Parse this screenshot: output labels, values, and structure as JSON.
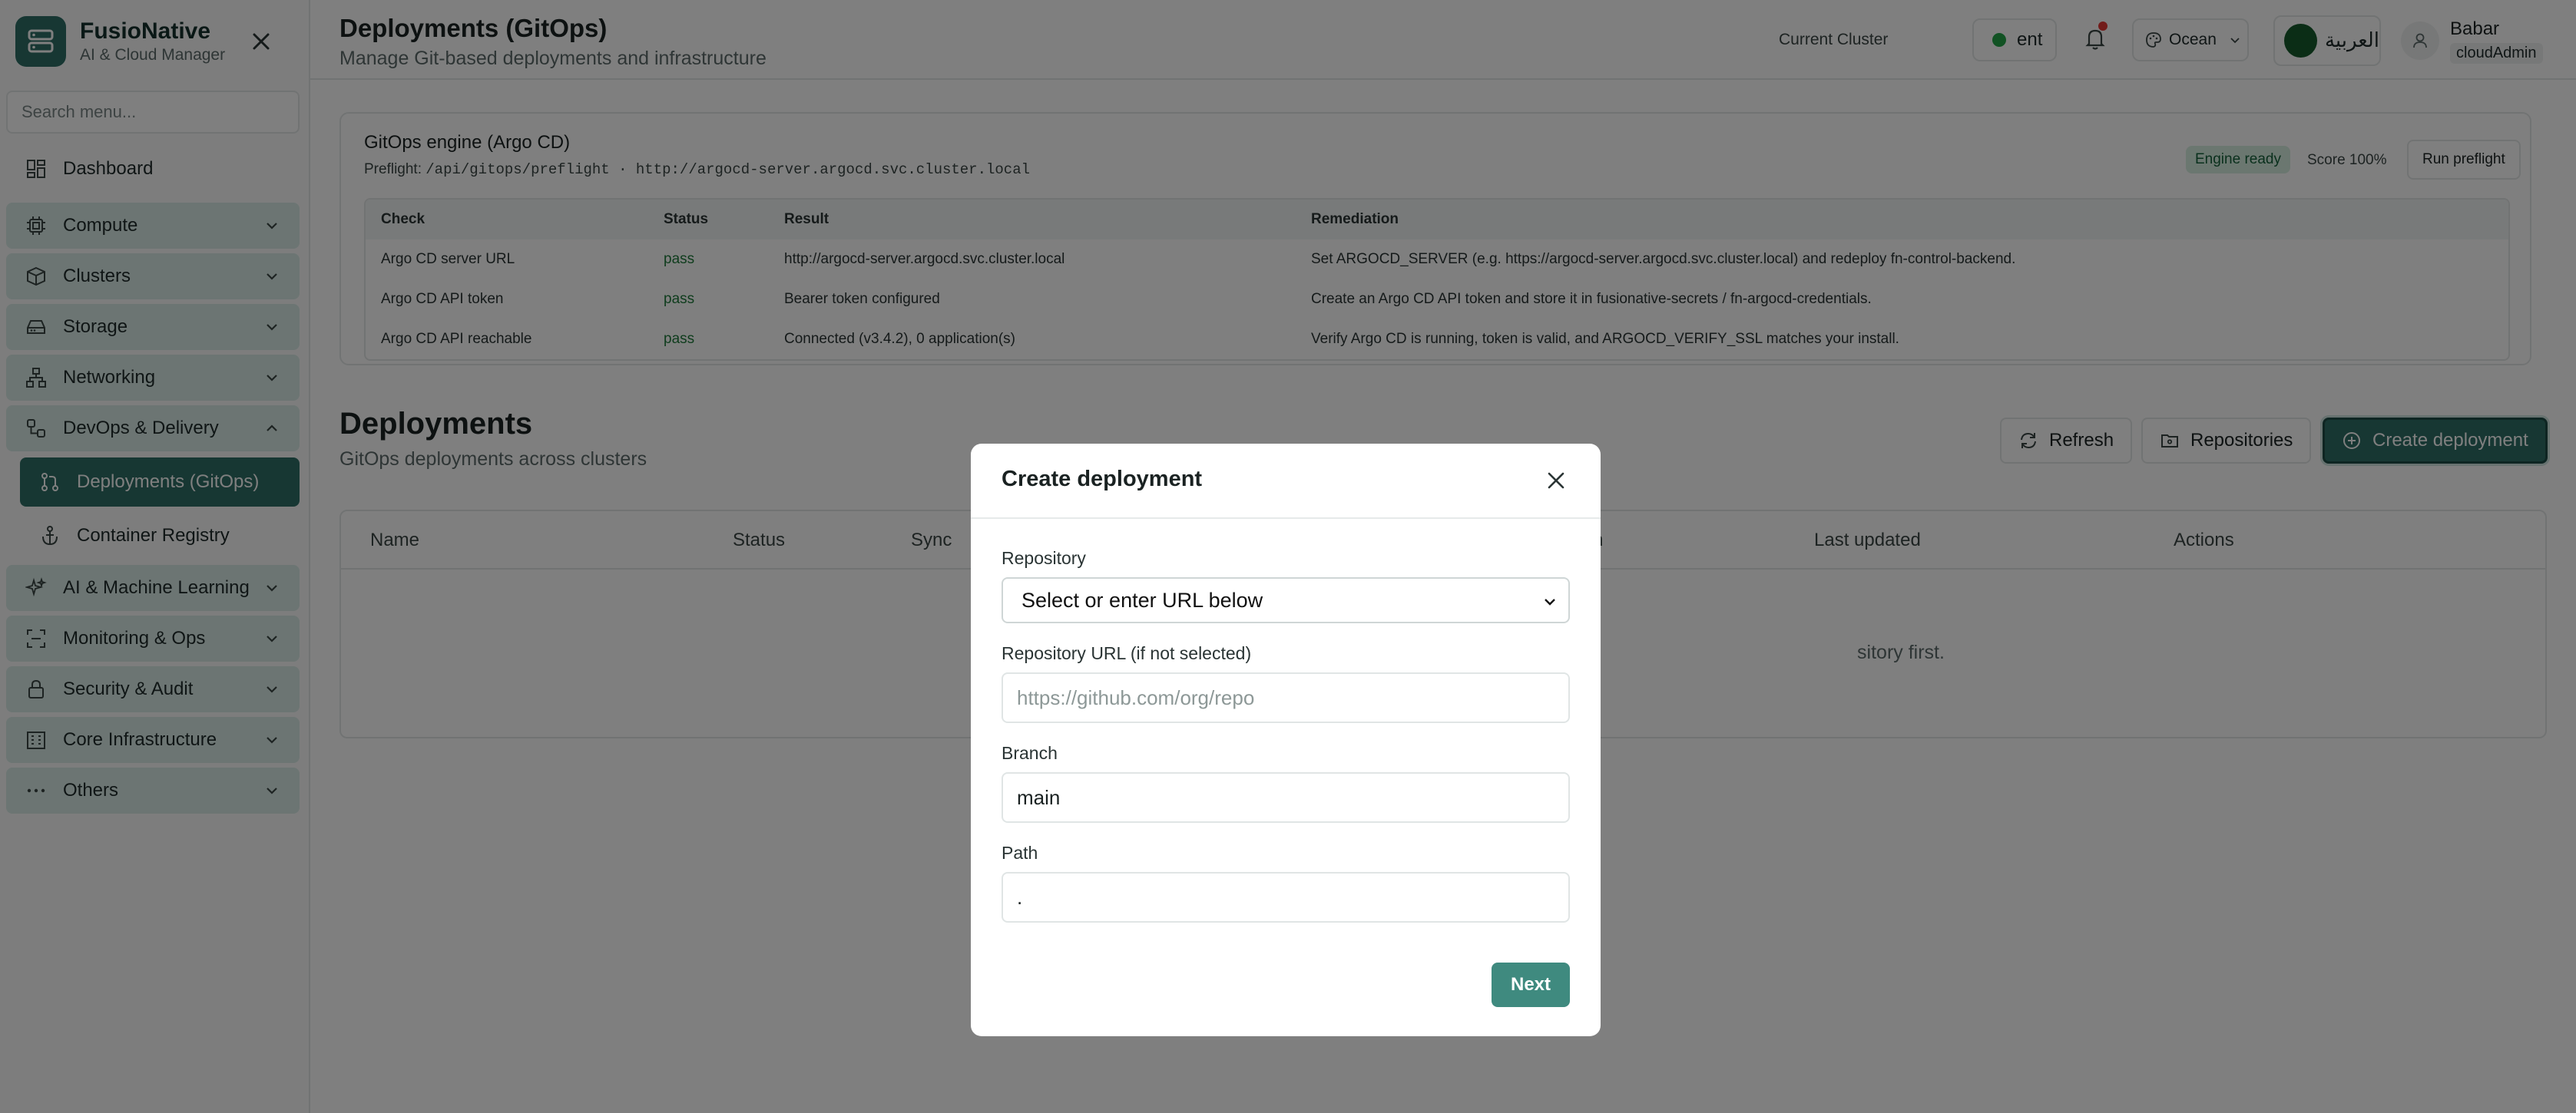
{
  "app": {
    "name": "FusioNative",
    "subtitle": "AI & Cloud Manager"
  },
  "sidebar": {
    "search_placeholder": "Search menu...",
    "items": [
      {
        "label": "Dashboard"
      },
      {
        "label": "Compute"
      },
      {
        "label": "Clusters"
      },
      {
        "label": "Storage"
      },
      {
        "label": "Networking"
      },
      {
        "label": "DevOps & Delivery"
      },
      {
        "label": "Deployments (GitOps)"
      },
      {
        "label": "Container Registry"
      },
      {
        "label": "AI & Machine Learning"
      },
      {
        "label": "Monitoring & Ops"
      },
      {
        "label": "Security & Audit"
      },
      {
        "label": "Core Infrastructure"
      },
      {
        "label": "Others"
      }
    ]
  },
  "header": {
    "title": "Deployments (GitOps)",
    "subtitle": "Manage Git-based deployments and infrastructure",
    "cluster_label": "Current Cluster",
    "cluster_value": "ent",
    "theme": "Ocean",
    "language": "العربية",
    "user_name": "Babar",
    "user_role": "cloudAdmin"
  },
  "preflight": {
    "title": "GitOps engine (Argo CD)",
    "prefix": "Preflight: ",
    "endpoint": "/api/gitops/preflight · http://argocd-server.argocd.svc.cluster.local",
    "status_badge": "Engine ready",
    "score": "Score 100%",
    "run_button": "Run preflight",
    "columns": [
      "Check",
      "Status",
      "Result",
      "Remediation"
    ],
    "rows": [
      {
        "check": "Argo CD server URL",
        "status": "pass",
        "result": "http://argocd-server.argocd.svc.cluster.local",
        "remediation": "Set ARGOCD_SERVER (e.g. https://argocd-server.argocd.svc.cluster.local) and redeploy fn-control-backend."
      },
      {
        "check": "Argo CD API token",
        "status": "pass",
        "result": "Bearer token configured",
        "remediation": "Create an Argo CD API token and store it in fusionative-secrets / fn-argocd-credentials."
      },
      {
        "check": "Argo CD API reachable",
        "status": "pass",
        "result": "Connected (v3.4.2), 0 application(s)",
        "remediation": "Verify Argo CD is running, token is valid, and ARGOCD_VERIFY_SSL matches your install."
      }
    ]
  },
  "deployments": {
    "title": "Deployments",
    "subtitle": "GitOps deployments across clusters",
    "refresh_button": "Refresh",
    "repositories_button": "Repositories",
    "create_button": "Create deployment",
    "columns": [
      "Name",
      "Status",
      "Sync",
      "h",
      "Last updated",
      "Actions"
    ],
    "empty_text_visible": "sitory first."
  },
  "modal": {
    "title": "Create deployment",
    "repository_label": "Repository",
    "repository_select": "Select or enter URL below",
    "repo_url_label": "Repository URL (if not selected)",
    "repo_url_placeholder": "https://github.com/org/repo",
    "branch_label": "Branch",
    "branch_value": "main",
    "path_label": "Path",
    "path_value": ".",
    "next_button": "Next"
  },
  "colors": {
    "brand": "#2f6f66",
    "group_bg": "#d8ebe6",
    "pass": "#1e7a3b",
    "overlay": "rgba(0,0,0,0.5)"
  }
}
